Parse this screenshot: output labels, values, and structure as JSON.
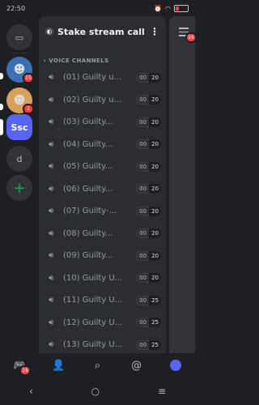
{
  "status": {
    "time": "22:50",
    "battery": "11"
  },
  "rail": {
    "server1_badge": "15",
    "server2_badge": "1",
    "server3_abbr": "Ssc",
    "server4_abbr": "d",
    "add_label": "+"
  },
  "server": {
    "name": "Stake stream call",
    "icon_glyph": "◐"
  },
  "category": {
    "label": "VOICE CHANNELS"
  },
  "channels": [
    {
      "name": "(01) Guilty u...",
      "users": "00",
      "limit": "20"
    },
    {
      "name": "(02) Guilty u...",
      "users": "00",
      "limit": "20"
    },
    {
      "name": "(03) Guilty...",
      "users": "00",
      "limit": "20"
    },
    {
      "name": "(04) Guilty...",
      "users": "00",
      "limit": "20"
    },
    {
      "name": "(05) Guilty...",
      "users": "00",
      "limit": "20"
    },
    {
      "name": "(06) Guilty...",
      "users": "00",
      "limit": "20"
    },
    {
      "name": "(07) Guilty-...",
      "users": "00",
      "limit": "20"
    },
    {
      "name": "(08) Guilty...",
      "users": "00",
      "limit": "20"
    },
    {
      "name": "(09) Guilty...",
      "users": "00",
      "limit": "20"
    },
    {
      "name": "(10) Guilty U...",
      "users": "00",
      "limit": "20"
    },
    {
      "name": "(11) Guilty U...",
      "users": "00",
      "limit": "25"
    },
    {
      "name": "(12) Guilty U...",
      "users": "00",
      "limit": "25"
    },
    {
      "name": "(13) Guilty U...",
      "users": "00",
      "limit": "25"
    }
  ],
  "right_badge": "16",
  "tabs": {
    "home_badge": "16"
  },
  "icons": {
    "speaker": "speaker-icon",
    "menu": "menu-icon",
    "home": "discord-icon",
    "friends": "friends-icon",
    "search": "search-icon",
    "mentions": "at-icon",
    "profile": "avatar"
  }
}
